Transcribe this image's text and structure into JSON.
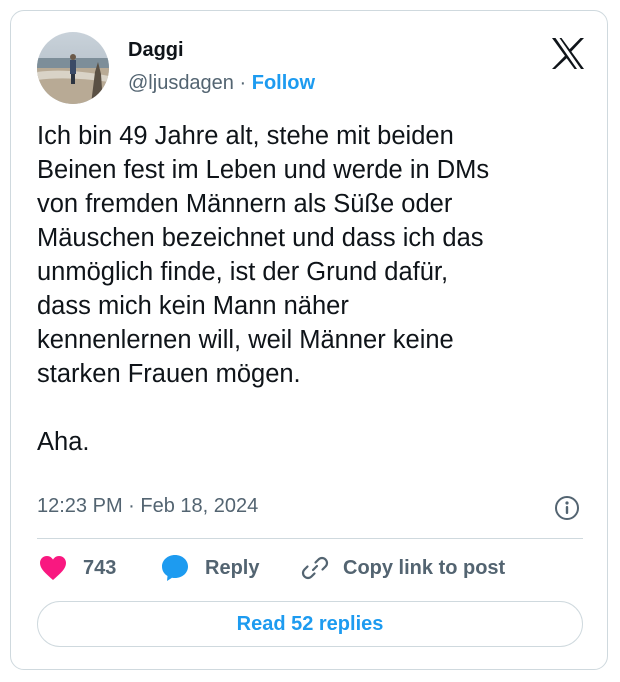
{
  "author": {
    "name": "Daggi",
    "handle": "@ljusdagen",
    "separator": "·",
    "follow_label": "Follow"
  },
  "tweet": {
    "text": "Ich bin 49 Jahre alt, stehe mit beiden\nBeinen fest im Leben und werde in DMs\nvon fremden Männern als Süße oder\nMäuschen bezeichnet und dass ich das\nunmöglich finde, ist der Grund dafür,\ndass mich kein Mann näher\nkennenlernen will, weil Männer keine\nstarken Frauen mögen.\n\nAha.",
    "timestamp": "12:23 PM · Feb 18, 2024"
  },
  "actions": {
    "like_count": "743",
    "reply_label": "Reply",
    "copy_link_label": "Copy link to post"
  },
  "read_replies_label": "Read 52 replies",
  "icons": {
    "brand": "x-logo-icon",
    "info": "info-icon",
    "like": "heart-icon",
    "reply": "speech-bubble-icon",
    "copy": "link-icon"
  },
  "colors": {
    "accent": "#1d9bf0",
    "like": "#f91880",
    "secondary_text": "#536471",
    "border": "#cfd9de"
  }
}
